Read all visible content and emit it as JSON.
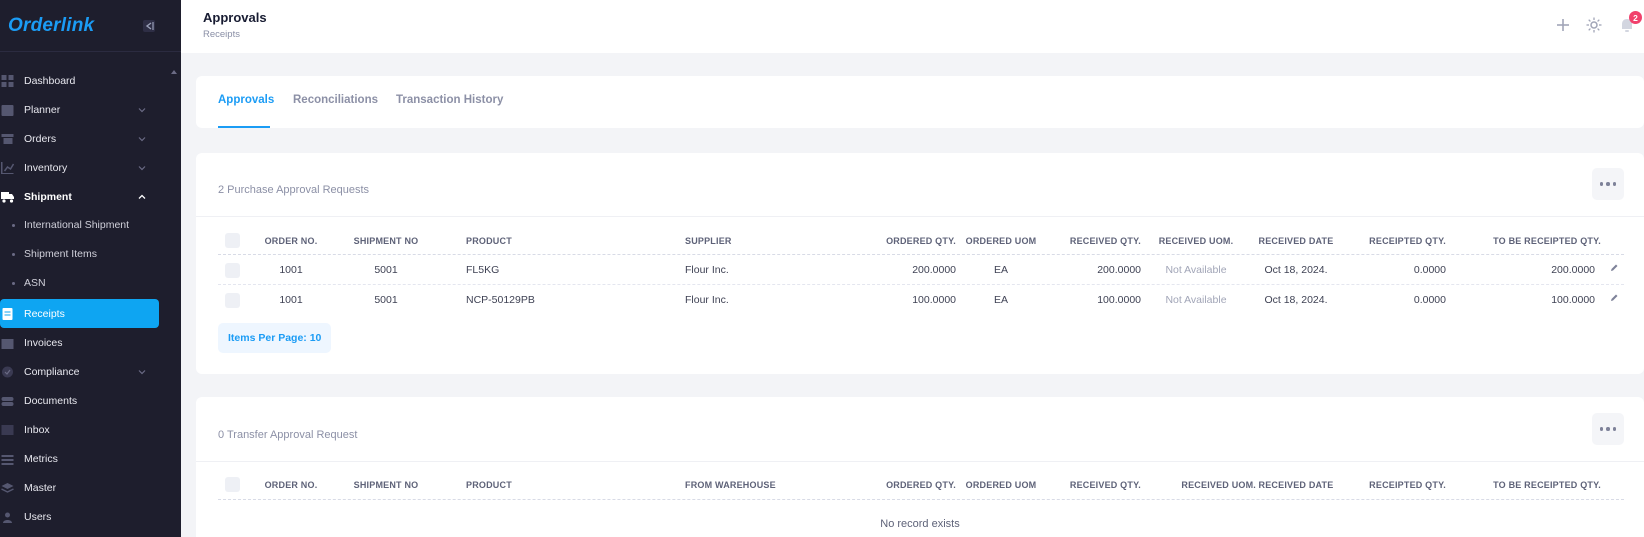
{
  "sidebar": {
    "brand": "Orderlink",
    "items": [
      {
        "label": "Dashboard",
        "icon": "dashboard-icon"
      },
      {
        "label": "Planner",
        "icon": "calendar-icon",
        "has_chevron": true
      },
      {
        "label": "Orders",
        "icon": "cart-icon",
        "has_chevron": true
      },
      {
        "label": "Inventory",
        "icon": "chart-icon",
        "has_chevron": true
      },
      {
        "label": "Shipment",
        "icon": "truck-icon",
        "expanded": true
      },
      {
        "label": "Receipts",
        "icon": "receipt-icon",
        "active": true
      },
      {
        "label": "Invoices",
        "icon": "invoice-icon"
      },
      {
        "label": "Compliance",
        "icon": "shield-icon",
        "has_chevron": true
      },
      {
        "label": "Documents",
        "icon": "folder-icon"
      },
      {
        "label": "Inbox",
        "icon": "inbox-icon"
      },
      {
        "label": "Metrics",
        "icon": "metrics-icon"
      },
      {
        "label": "Master",
        "icon": "layers-icon"
      },
      {
        "label": "Users",
        "icon": "user-icon"
      }
    ],
    "shipment_subitems": [
      "International Shipment",
      "Shipment Items",
      "ASN"
    ]
  },
  "header": {
    "title": "Approvals",
    "subtitle": "Receipts",
    "notification_count": "2"
  },
  "tabs": [
    {
      "label": "Approvals",
      "active": true
    },
    {
      "label": "Reconciliations"
    },
    {
      "label": "Transaction History"
    }
  ],
  "purchase": {
    "title": "2 Purchase Approval Requests",
    "columns": [
      "ORDER NO.",
      "SHIPMENT NO",
      "PRODUCT",
      "SUPPLIER",
      "ORDERED QTY.",
      "ORDERED UOM",
      "RECEIVED QTY.",
      "RECEIVED UOM.",
      "RECEIVED DATE",
      "RECEIPTED QTY.",
      "TO BE RECEIPTED QTY."
    ],
    "rows": [
      [
        "1001",
        "5001",
        "FL5KG",
        "Flour Inc.",
        "200.0000",
        "EA",
        "200.0000",
        "Not Available",
        "Oct 18, 2024.",
        "0.0000",
        "200.0000"
      ],
      [
        "1001",
        "5001",
        "NCP-50129PB",
        "Flour Inc.",
        "100.0000",
        "EA",
        "100.0000",
        "Not Available",
        "Oct 18, 2024.",
        "0.0000",
        "100.0000"
      ]
    ],
    "items_per_page": "Items Per Page: 10"
  },
  "transfer": {
    "title": "0 Transfer Approval Request",
    "columns": [
      "ORDER NO.",
      "SHIPMENT NO",
      "PRODUCT",
      "FROM WAREHOUSE",
      "ORDERED QTY.",
      "ORDERED UOM",
      "RECEIVED QTY.",
      "RECEIVED UOM.",
      "RECEIVED DATE",
      "RECEIPTED QTY.",
      "TO BE RECEIPTED QTY."
    ],
    "empty_message": "No record exists"
  },
  "colors": {
    "accent": "#0ea5f2",
    "sidebar_bg": "#1e1e2d",
    "badge": "#f1416c"
  }
}
